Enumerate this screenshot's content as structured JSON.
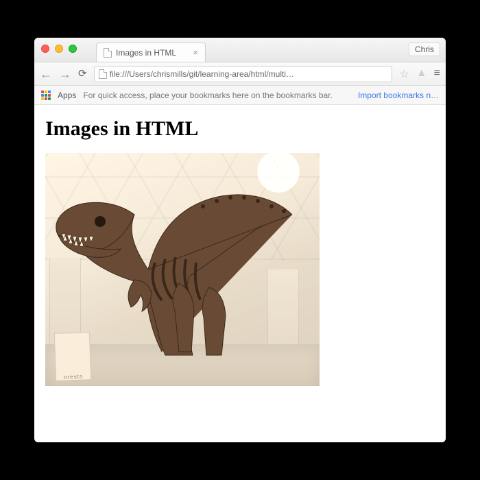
{
  "window": {
    "profile_name": "Chris"
  },
  "tab": {
    "title": "Images in HTML"
  },
  "toolbar": {
    "url": "file:///Users/chrismills/git/learning-area/html/multi…"
  },
  "bookmarks_bar": {
    "apps_label": "Apps",
    "hint": "For quick access, place your bookmarks here on the bookmarks bar.",
    "import_link": "Import bookmarks n…"
  },
  "page": {
    "heading": "Images in HTML",
    "image_alt": "A T-Rex skeleton on display in a museum hall",
    "sign_text": "orests"
  },
  "icons": {
    "back": "←",
    "forward": "→",
    "reload": "⟳",
    "file": "file-icon",
    "close_tab": "×",
    "star": "☆",
    "drive": "▲",
    "menu": "≡"
  }
}
